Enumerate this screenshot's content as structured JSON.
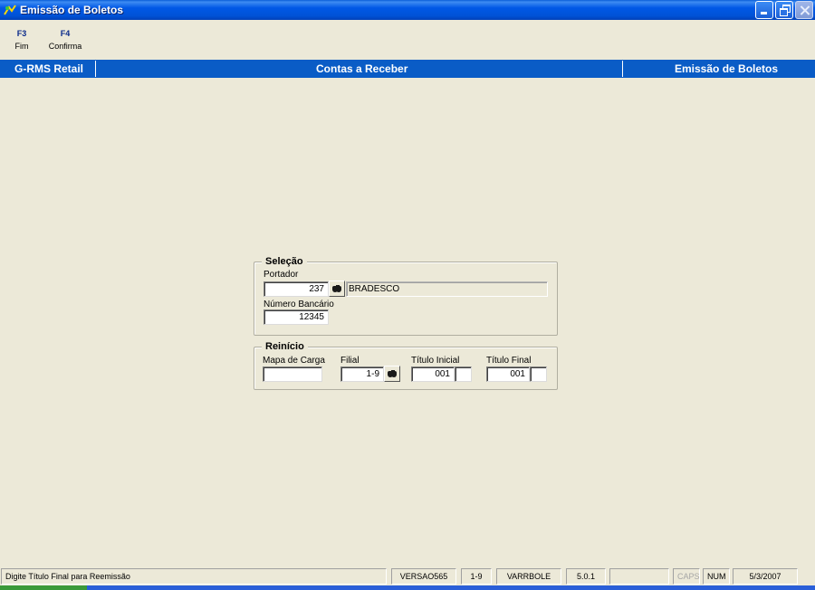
{
  "window": {
    "title": "Emissão de Boletos"
  },
  "function_keys": [
    {
      "key": "F3",
      "label": "Fim"
    },
    {
      "key": "F4",
      "label": "Confirma"
    }
  ],
  "header": {
    "system": "G-RMS Retail",
    "module": "Contas a Receber",
    "screen": "Emissão de Boletos"
  },
  "selecao": {
    "title": "Seleção",
    "portador_label": "Portador",
    "portador_value": "237",
    "portador_name": "BRADESCO",
    "numero_bancario_label": "Número Bancário",
    "numero_bancario_value": "12345"
  },
  "reinicio": {
    "title": "Reinício",
    "mapa_carga_label": "Mapa de Carga",
    "mapa_carga_value": "",
    "filial_label": "Filial",
    "filial_value": "1-9",
    "titulo_inicial_label": "Título Inicial",
    "titulo_inicial_value": "001",
    "titulo_inicial_suffix": "",
    "titulo_final_label": "Título Final",
    "titulo_final_value": "001",
    "titulo_final_suffix": ""
  },
  "status_bar": {
    "message": "Digite Título Final para Reemissão",
    "version": "VERSAO565",
    "filial": "1-9",
    "program": "VARRBOLE",
    "release": "5.0.1",
    "blank": "",
    "caps": "CAPS",
    "num": "NUM",
    "date": "5/3/2007"
  }
}
